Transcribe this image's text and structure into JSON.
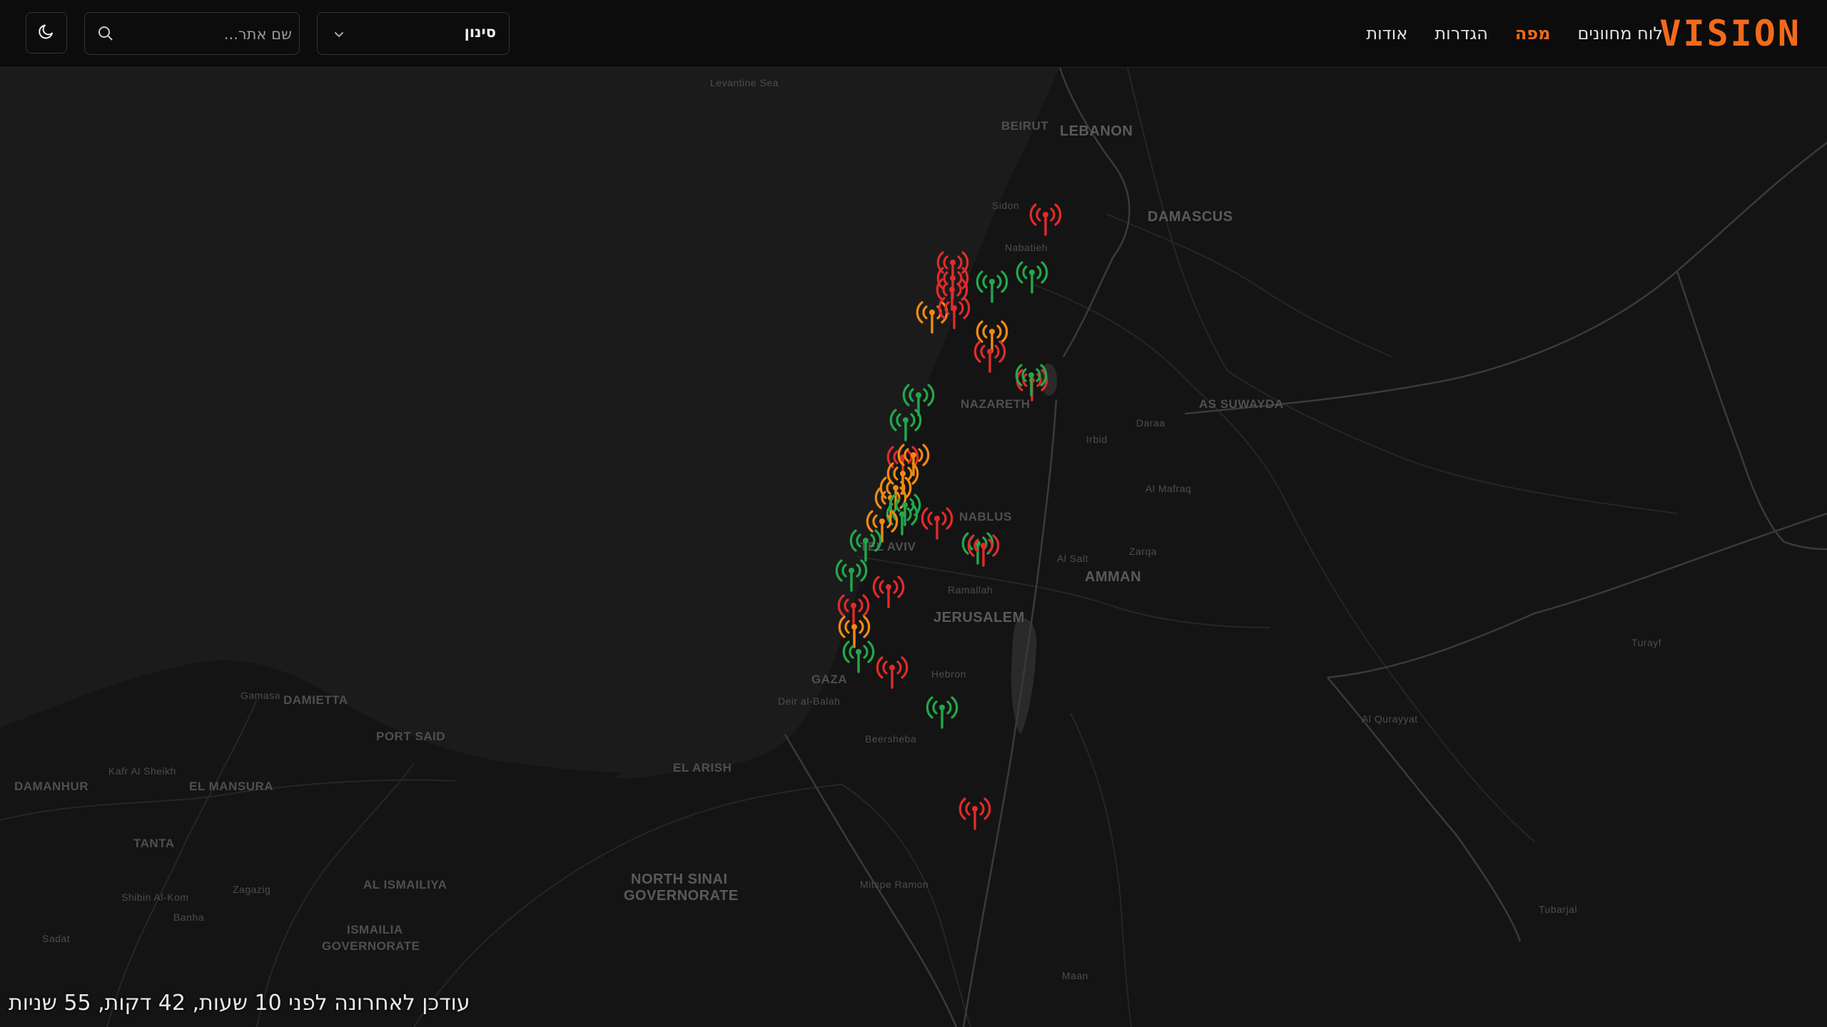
{
  "app": {
    "logo": "VISION"
  },
  "nav": {
    "items": [
      {
        "label": "לוח מחוונים",
        "active": false
      },
      {
        "label": "מפה",
        "active": true
      },
      {
        "label": "הגדרות",
        "active": false
      },
      {
        "label": "אודות",
        "active": false
      }
    ]
  },
  "search": {
    "placeholder": "שם אתר..."
  },
  "filter": {
    "label": "סינון"
  },
  "icons": {
    "theme": "moon-icon",
    "search": "search-icon",
    "chevron": "chevron-down-icon",
    "marker": "antenna-icon"
  },
  "colors": {
    "brand": "#f26a1b",
    "online": "#22a84a",
    "warning": "#f08a12",
    "offline": "#e02b2b"
  },
  "map": {
    "labels": {
      "sea": "Levantine Sea",
      "beirut": "BEIRUT",
      "lebanon": "LEBANON",
      "sidon": "Sidon",
      "nabatieh": "Nabatieh",
      "damascus": "DAMASCUS",
      "as_suwayda": "AS SUWAYDA",
      "daraa": "Daraa",
      "irbid": "Irbid",
      "al_mafraq": "Al Mafraq",
      "nazareth": "NAZARETH",
      "nablus": "NABLUS",
      "zarqa": "Zarqa",
      "al_salt": "Al Salt",
      "amman": "AMMAN",
      "tel_aviv": "TEL AVIV",
      "ramallah": "Ramallah",
      "jerusalem": "JERUSALEM",
      "hebron": "Hebron",
      "gaza": "GAZA",
      "deir_al_balah": "Deir al-Balah",
      "beersheba": "Beersheba",
      "mitspe_ramon": "Mitspe Ramon",
      "maan": "Maan",
      "turayf": "Turayf",
      "al_qurayyat": "Al Qurayyat",
      "tubarjal": "Tubarjal",
      "damietta": "DAMIETTA",
      "gamasa": "Gamasa",
      "port_said": "PORT SAID",
      "el_arish": "EL ARISH",
      "kafr_al_sheikh": "Kafr Al Sheikh",
      "damanhur": "DAMANHUR",
      "el_mansura": "EL MANSURA",
      "tanta": "TANTA",
      "north_sinai_1": "NORTH SINAI",
      "north_sinai_2": "GOVERNORATE",
      "al_ismailiya": "AL ISMAILIYA",
      "shibin": "Shibin Al-Kom",
      "zagazig": "Zagazig",
      "banha": "Banha",
      "sadat": "Sadat",
      "ismailia_1": "ISMAILIA",
      "ismailia_2": "GOVERNORATE"
    },
    "sites": [
      {
        "status": "offline"
      },
      {
        "status": "offline"
      },
      {
        "status": "online"
      },
      {
        "status": "online"
      },
      {
        "status": "offline"
      },
      {
        "status": "warning"
      },
      {
        "status": "offline"
      },
      {
        "status": "offline"
      },
      {
        "status": "warning"
      },
      {
        "status": "offline"
      },
      {
        "status": "offline"
      },
      {
        "status": "online"
      },
      {
        "status": "online"
      },
      {
        "status": "offline"
      },
      {
        "status": "warning"
      },
      {
        "status": "warning"
      },
      {
        "status": "warning"
      },
      {
        "status": "warning"
      },
      {
        "status": "online"
      },
      {
        "status": "online"
      },
      {
        "status": "offline"
      },
      {
        "status": "warning"
      },
      {
        "status": "online"
      },
      {
        "status": "online"
      },
      {
        "status": "online"
      },
      {
        "status": "offline"
      },
      {
        "status": "offline"
      },
      {
        "status": "warning"
      },
      {
        "status": "online"
      },
      {
        "status": "offline"
      },
      {
        "status": "online"
      },
      {
        "status": "offline"
      },
      {
        "status": "offline"
      },
      {
        "status": "online"
      }
    ]
  },
  "status_bar": {
    "text": "עודכן לאחרונה לפני 10 שעות, 42 דקות, 55 שניות"
  }
}
